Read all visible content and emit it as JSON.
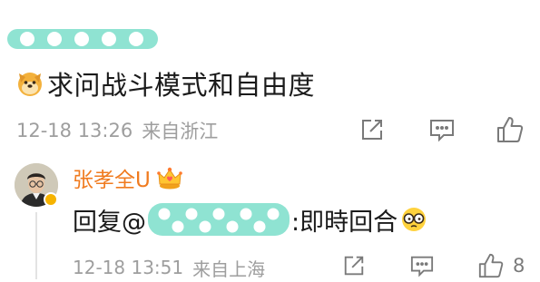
{
  "comment": {
    "text": "求问战斗模式和自由度",
    "time": "12-18 13:26",
    "location": "来自浙江"
  },
  "reply": {
    "username": "张孝全U",
    "prefix": "回复@",
    "suffix": ":即時回合",
    "time": "12-18 13:51",
    "location": "来自上海",
    "like_count": "8"
  },
  "colors": {
    "username": "#f07b1f",
    "mention": "#3b6fb6",
    "meta": "#9e9e9e",
    "icon": "#7a7a7a",
    "redaction": "#7fd9c8"
  },
  "icons": [
    "dog-emoji",
    "share-icon",
    "comment-icon",
    "like-icon",
    "vip-crown-icon",
    "verified-badge-icon",
    "glasses-emoji"
  ]
}
